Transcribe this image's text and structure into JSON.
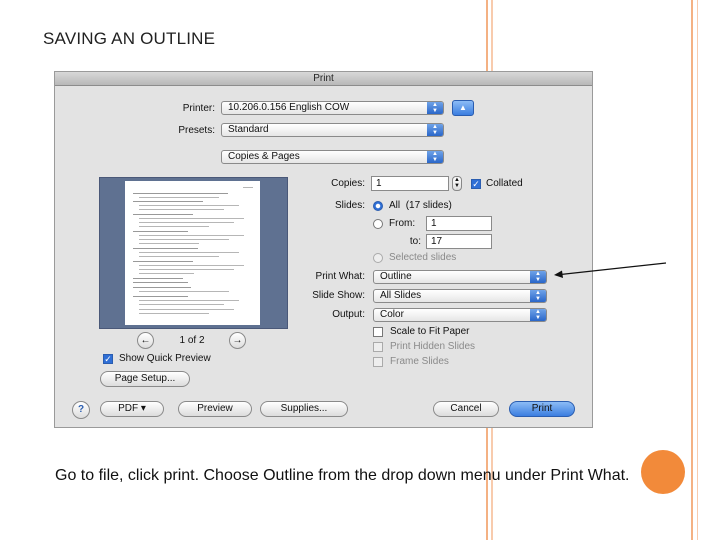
{
  "slide": {
    "title": "SAVING AN OUTLINE",
    "caption": "Go to file, click print.  Choose Outline from the drop down menu under Print What."
  },
  "colors": {
    "accent_lines": "#f4b183",
    "dot": "#f28a3a",
    "select_blue": "#2f6fd6"
  },
  "dialog": {
    "title": "Print",
    "printer": {
      "label": "Printer:",
      "value": "10.206.0.156 English COW"
    },
    "presets": {
      "label": "Presets:",
      "value": "Standard"
    },
    "section": {
      "value": "Copies & Pages"
    },
    "copies": {
      "label": "Copies:",
      "value": "1",
      "collated_label": "Collated",
      "collated": true
    },
    "slides": {
      "label": "Slides:",
      "all_label": "All",
      "all_count": "(17 slides)",
      "from_label": "From:",
      "from_value": "1",
      "to_label": "to:",
      "to_value": "17",
      "selected_label": "Selected slides"
    },
    "print_what": {
      "label": "Print What:",
      "value": "Outline"
    },
    "slide_show": {
      "label": "Slide Show:",
      "value": "All Slides"
    },
    "output": {
      "label": "Output:",
      "value": "Color"
    },
    "options": {
      "scale_to_fit": "Scale to Fit Paper",
      "print_hidden": "Print Hidden Slides",
      "frame_slides": "Frame Slides"
    },
    "preview": {
      "page_indicator": "1 of 2",
      "show_quick_preview": "Show Quick Preview",
      "show_quick_preview_checked": true
    },
    "page_setup_button": "Page Setup...",
    "footer": {
      "help": "?",
      "pdf": "PDF ▾",
      "preview": "Preview",
      "supplies": "Supplies...",
      "cancel": "Cancel",
      "print": "Print"
    },
    "icons": {
      "arrow": "chevron-updown-icon",
      "disclosure": "disclosure-triangle-icon",
      "prev": "arrow-left-icon",
      "next": "arrow-right-icon"
    }
  }
}
